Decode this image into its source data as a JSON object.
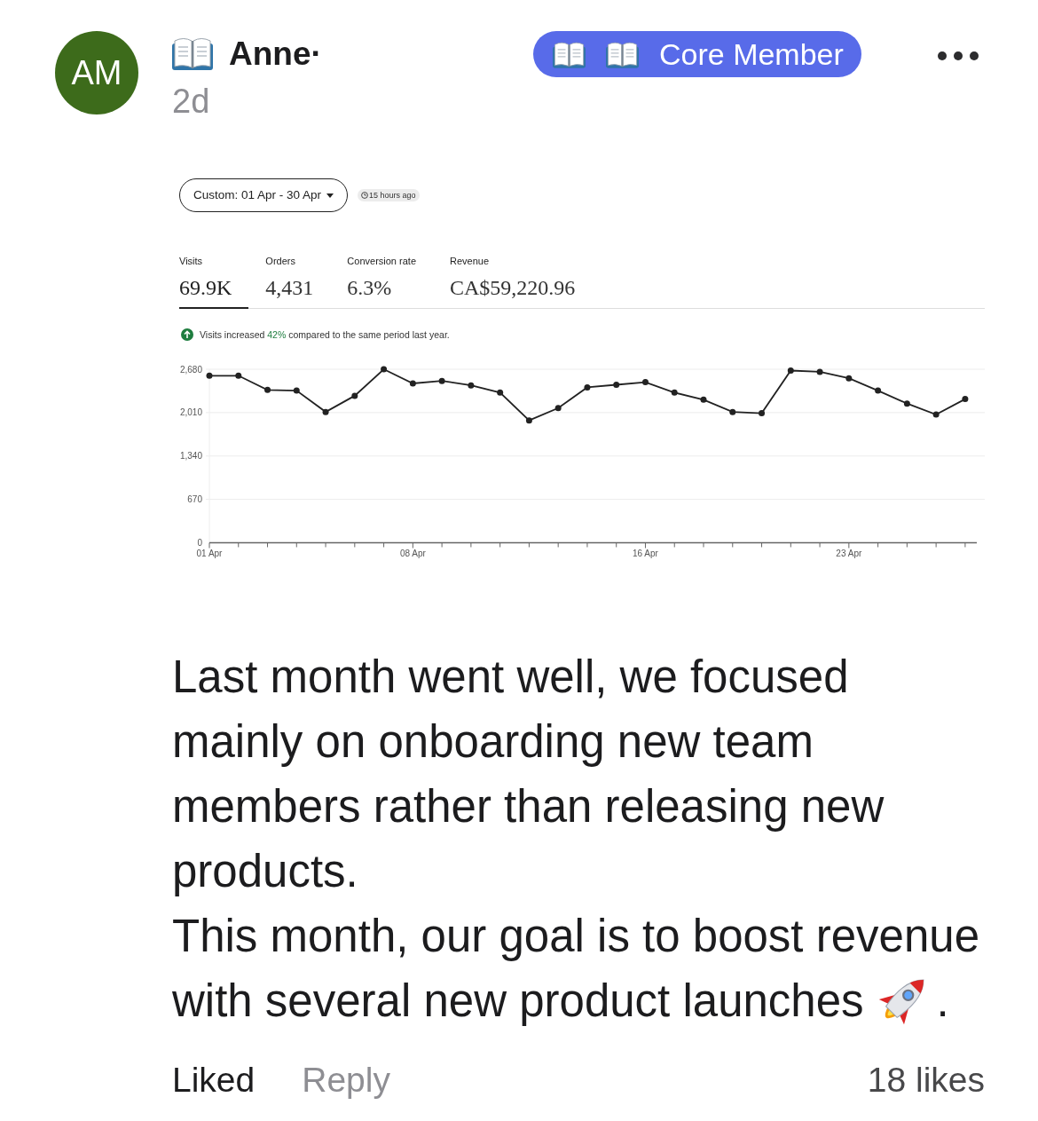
{
  "author": {
    "initials": "AM",
    "name": "Anne·",
    "time": "2d"
  },
  "badge": {
    "label": "Core Member"
  },
  "dashboard": {
    "date_range": "Custom: 01 Apr - 30 Apr",
    "updated": "15 hours ago",
    "metrics": [
      {
        "label": "Visits",
        "value": "69.9K",
        "selected": true
      },
      {
        "label": "Orders",
        "value": "4,431",
        "selected": false
      },
      {
        "label": "Conversion rate",
        "value": "6.3%",
        "selected": false
      },
      {
        "label": "Revenue",
        "value": "CA$59,220.96",
        "selected": false
      }
    ],
    "notice": "Visits increased **42%** compared to the same period last year.",
    "chart_data": {
      "type": "line",
      "categories": [
        "01 Apr",
        null,
        null,
        null,
        null,
        null,
        null,
        "08 Apr",
        null,
        null,
        null,
        null,
        null,
        null,
        null,
        "16 Apr",
        null,
        null,
        null,
        null,
        null,
        null,
        "23 Apr",
        null,
        null,
        null,
        null
      ],
      "series": [
        {
          "color": "#222222",
          "marker": "circle",
          "values": [
            2580,
            2580,
            2360,
            2350,
            2020,
            2270,
            2680,
            2460,
            2500,
            2430,
            2320,
            1890,
            2080,
            2400,
            2440,
            2480,
            2320,
            2210,
            2020,
            2000,
            2660,
            2640,
            2540,
            2350,
            2150,
            1980,
            2220
          ]
        }
      ],
      "ylim": [
        0,
        2680
      ],
      "yticks": [
        {
          "value": 0,
          "label": "0"
        },
        {
          "value": 670,
          "label": "670"
        },
        {
          "value": 1340,
          "label": "1,340"
        },
        {
          "value": 2010,
          "label": "2,010"
        },
        {
          "value": 2680,
          "label": "2,680"
        }
      ],
      "grid": true
    }
  },
  "post": {
    "paragraphs": [
      "Last month went well, we focused mainly on onboarding new team members rather than releasing new products.",
      "This month, our goal is to boost revenue with several new product launches"
    ],
    "closing": "."
  },
  "actions": {
    "like": "Liked",
    "liked": true,
    "reply": "Reply",
    "likes": "18 likes"
  }
}
